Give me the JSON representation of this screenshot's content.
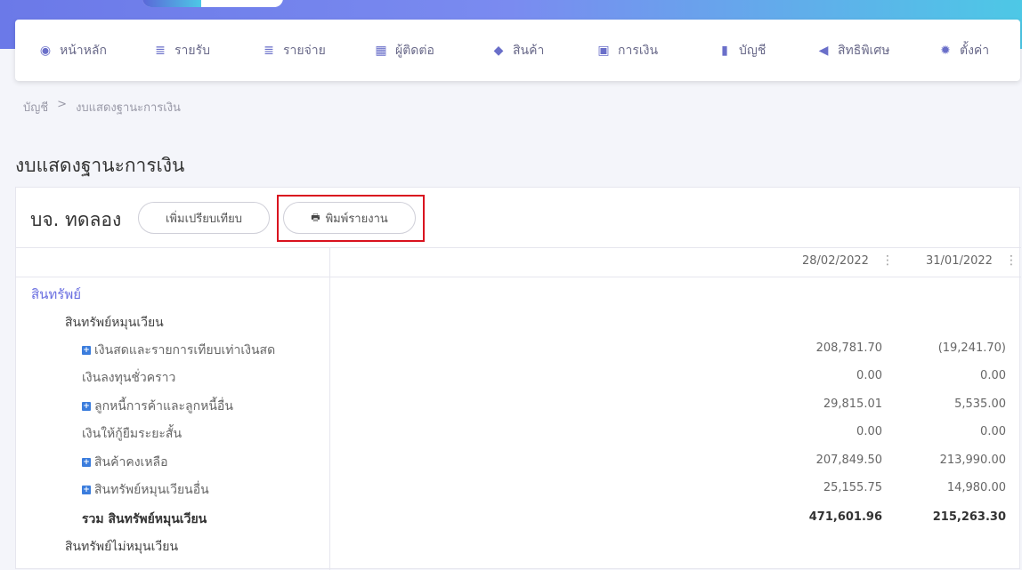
{
  "nav": {
    "items": [
      {
        "label": "หน้าหลัก",
        "icon": "dashboard-icon"
      },
      {
        "label": "รายรับ",
        "icon": "income-icon"
      },
      {
        "label": "รายจ่าย",
        "icon": "expense-icon"
      },
      {
        "label": "ผู้ติดต่อ",
        "icon": "contacts-icon"
      },
      {
        "label": "สินค้า",
        "icon": "box-icon"
      },
      {
        "label": "การเงิน",
        "icon": "money-icon"
      },
      {
        "label": "บัญชี",
        "icon": "book-icon"
      },
      {
        "label": "สิทธิพิเศษ",
        "icon": "megaphone-icon"
      },
      {
        "label": "ตั้งค่า",
        "icon": "gear-icon"
      }
    ]
  },
  "breadcrumb": {
    "root": "บัญชี",
    "sep": ">",
    "current": "งบแสดงฐานะการเงิน"
  },
  "page_title": "งบแสดงฐานะการเงิน",
  "report": {
    "company": "บจ. ทดลอง",
    "compare_label": "เพิ่มเปรียบเทียบ",
    "print_label": "พิมพ์รายงาน",
    "columns": [
      "28/02/2022",
      "31/01/2022"
    ],
    "rows": [
      {
        "label": "สินทรัพย์",
        "level": 0
      },
      {
        "label": "สินทรัพย์หมุนเวียน",
        "level": 1
      },
      {
        "label": "เงินสดและรายการเทียบเท่าเงินสด",
        "level": 2,
        "expand": true,
        "v1": "208,781.70",
        "v2": "(19,241.70)"
      },
      {
        "label": "เงินลงทุนชั่วคราว",
        "level": 2,
        "v1": "0.00",
        "v2": "0.00"
      },
      {
        "label": "ลูกหนี้การค้าและลูกหนี้อื่น",
        "level": 2,
        "expand": true,
        "v1": "29,815.01",
        "v2": "5,535.00"
      },
      {
        "label": "เงินให้กู้ยืมระยะสั้น",
        "level": 2,
        "v1": "0.00",
        "v2": "0.00"
      },
      {
        "label": "สินค้าคงเหลือ",
        "level": 2,
        "expand": true,
        "v1": "207,849.50",
        "v2": "213,990.00"
      },
      {
        "label": "สินทรัพย์หมุนเวียนอื่น",
        "level": 2,
        "expand": true,
        "v1": "25,155.75",
        "v2": "14,980.00"
      },
      {
        "label": "รวม สินทรัพย์หมุนเวียน",
        "level": 2,
        "total": true,
        "v1": "471,601.96",
        "v2": "215,263.30"
      },
      {
        "label": "สินทรัพย์ไม่หมุนเวียน",
        "level": 1
      }
    ]
  }
}
